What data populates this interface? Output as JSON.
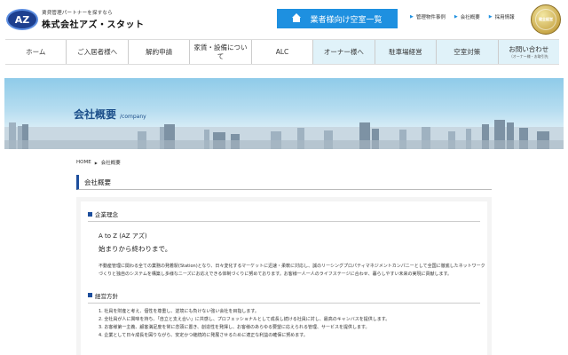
{
  "header": {
    "logo_badge": "AZ",
    "logo_tagline": "賃貸管理パートナーを探すなら",
    "logo_company": "株式会社アズ・スタット",
    "vacancy_button": "業者様向け空室一覧",
    "top_links": [
      "管理物件事例",
      "会社概要",
      "採用情報"
    ],
    "seal_text": "健全経営"
  },
  "nav": {
    "items": [
      {
        "label": "ホーム",
        "sub": ""
      },
      {
        "label": "ご入居者様へ",
        "sub": ""
      },
      {
        "label": "解約申請",
        "sub": ""
      },
      {
        "label": "家賃・設備について",
        "sub": ""
      },
      {
        "label": "ALC",
        "sub": ""
      },
      {
        "label": "オーナー様へ",
        "sub": ""
      },
      {
        "label": "駐車場経営",
        "sub": ""
      },
      {
        "label": "空室対策",
        "sub": ""
      },
      {
        "label": "お問い合わせ",
        "sub": "（オーナー様・お取引先"
      }
    ]
  },
  "banner": {
    "title": "会社概要",
    "subtitle": "/company"
  },
  "breadcrumb": {
    "home": "HOME",
    "current": "会社概要"
  },
  "section": {
    "title": "会社概要"
  },
  "philosophy": {
    "heading": "企業理念",
    "motto_line1": "A to Z (AZ アズ)",
    "motto_line2": "始まりから終わりまで。",
    "paragraph": "不動産管理に関わる全ての業務の発着駅(Station)となり、日々変化するマーケットに迅速・柔軟に対応し、誠のリーシングプロパティマネジメントカンパニーとして全国に徹底したネットワークづくりと独自のシステムを構築し多様なニーズにお応えできる体制づくりに努めております。お客様一人一人のライフステージに合わせ、暮らしやすい未来の実現に貢献します。"
  },
  "policy": {
    "heading": "経営方針",
    "items": [
      "1. 社員を財産と考え、個性を尊重し、逆境にも負けない強い会社を目指します。",
      "2. 全社員が人に興味を持ち、「自立と支え合い」に共感し、プロフェッショナルとして成長し続ける社員に対し、最高のキャンバスを提供します。",
      "3. お客様第一主義、顧客満足度を常に念頭に置き、創造性を発揮し、お客様のあらゆる要望に応えられる管理、サービスを提供します。",
      "4. 企業として日々成長を図りながら、安定かつ継続的に発展させるために適正な利益の確保に努めます。"
    ]
  },
  "colors": {
    "accent_blue": "#1e90e0",
    "heading_navy": "#1d4e9c",
    "owner_nav_bg": "#e0f2f9"
  }
}
